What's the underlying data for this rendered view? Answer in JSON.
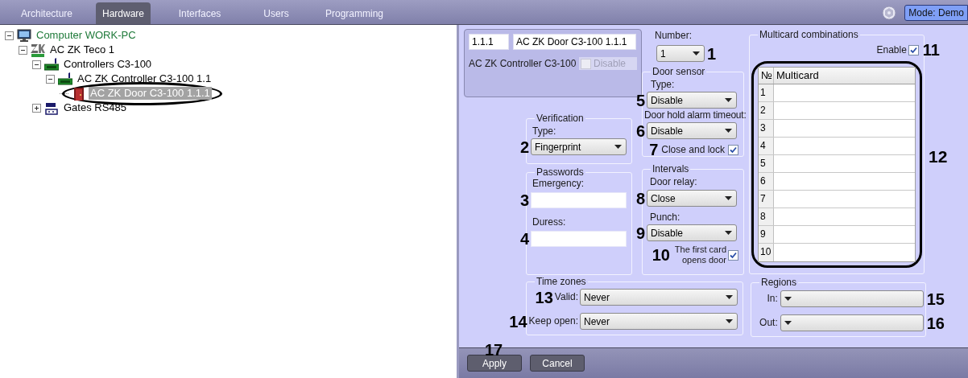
{
  "tabs": [
    {
      "label": "Architecture",
      "selected": false
    },
    {
      "label": "Hardware",
      "selected": true
    },
    {
      "label": "Interfaces",
      "selected": false
    },
    {
      "label": "Users",
      "selected": false
    },
    {
      "label": "Programming",
      "selected": false
    }
  ],
  "mode_button": "Mode: Demo",
  "tree": [
    {
      "label": "Computer WORK-PC",
      "kind": "computer",
      "expanded": true,
      "selected": false,
      "children": [
        {
          "label": "AC ZK Teco 1",
          "kind": "zk",
          "expanded": true,
          "selected": false,
          "children": [
            {
              "label": "Controllers C3-100",
              "kind": "controller",
              "expanded": true,
              "selected": false,
              "children": [
                {
                  "label": "AC ZK Controller C3-100 1.1",
                  "kind": "controller",
                  "expanded": true,
                  "selected": false,
                  "children": [
                    {
                      "label": "AC ZK Door C3-100 1.1.1",
                      "kind": "door",
                      "selected": true,
                      "highlighted": true
                    }
                  ]
                }
              ]
            },
            {
              "label": "Gates RS485",
              "kind": "rs485",
              "expanded": false,
              "selected": false
            }
          ]
        }
      ]
    }
  ],
  "header": {
    "id": "1.1.1",
    "name": "AC ZK Door C3-100 1.1.1",
    "controller": "AC ZK Controller C3-100",
    "disable": {
      "label": "Disable",
      "checked": false,
      "disabled": true
    }
  },
  "number": {
    "label": "Number:",
    "value": "1",
    "marker": "1"
  },
  "verification": {
    "title": "Verification",
    "type_label": "Type:",
    "type": "Fingerprint",
    "marker": "2"
  },
  "passwords": {
    "title": "Passwords",
    "fields": [
      {
        "label": "Emergency:",
        "marker": "3"
      },
      {
        "label": "Duress:",
        "marker": "4"
      }
    ]
  },
  "door_sensor": {
    "title": "Door sensor",
    "type_label": "Type:",
    "type": "Disable",
    "type_marker": "5",
    "timeout_label": "Door hold alarm timeout:",
    "timeout": "Disable",
    "timeout_marker": "6",
    "close_lock": {
      "label": "Close and lock",
      "checked": true,
      "marker": "7"
    }
  },
  "intervals": {
    "title": "Intervals",
    "relay_label": "Door relay:",
    "relay": "Close",
    "relay_marker": "8",
    "punch_label": "Punch:",
    "punch": "Disable",
    "punch_marker": "9",
    "first_card": {
      "label": "The first card opens door",
      "checked": true,
      "marker": "10"
    }
  },
  "multicard": {
    "title": "Multicard combinations",
    "enable": {
      "label": "Enable",
      "checked": true,
      "marker": "11"
    },
    "columns": [
      "№",
      "Multicard"
    ],
    "rows": [
      "1",
      "2",
      "3",
      "4",
      "5",
      "6",
      "7",
      "8",
      "9",
      "10"
    ],
    "marker": "12"
  },
  "time_zones": {
    "title": "Time zones",
    "fields": [
      {
        "label": "Valid:",
        "value": "Never",
        "marker": "13"
      },
      {
        "label": "Keep open:",
        "value": "Never",
        "marker": "14"
      }
    ]
  },
  "regions": {
    "title": "Regions",
    "fields": [
      {
        "label": "In:",
        "marker": "15"
      },
      {
        "label": "Out:",
        "marker": "16"
      }
    ]
  },
  "buttons": [
    {
      "label": "Apply",
      "marker": "17"
    },
    {
      "label": "Cancel"
    }
  ]
}
